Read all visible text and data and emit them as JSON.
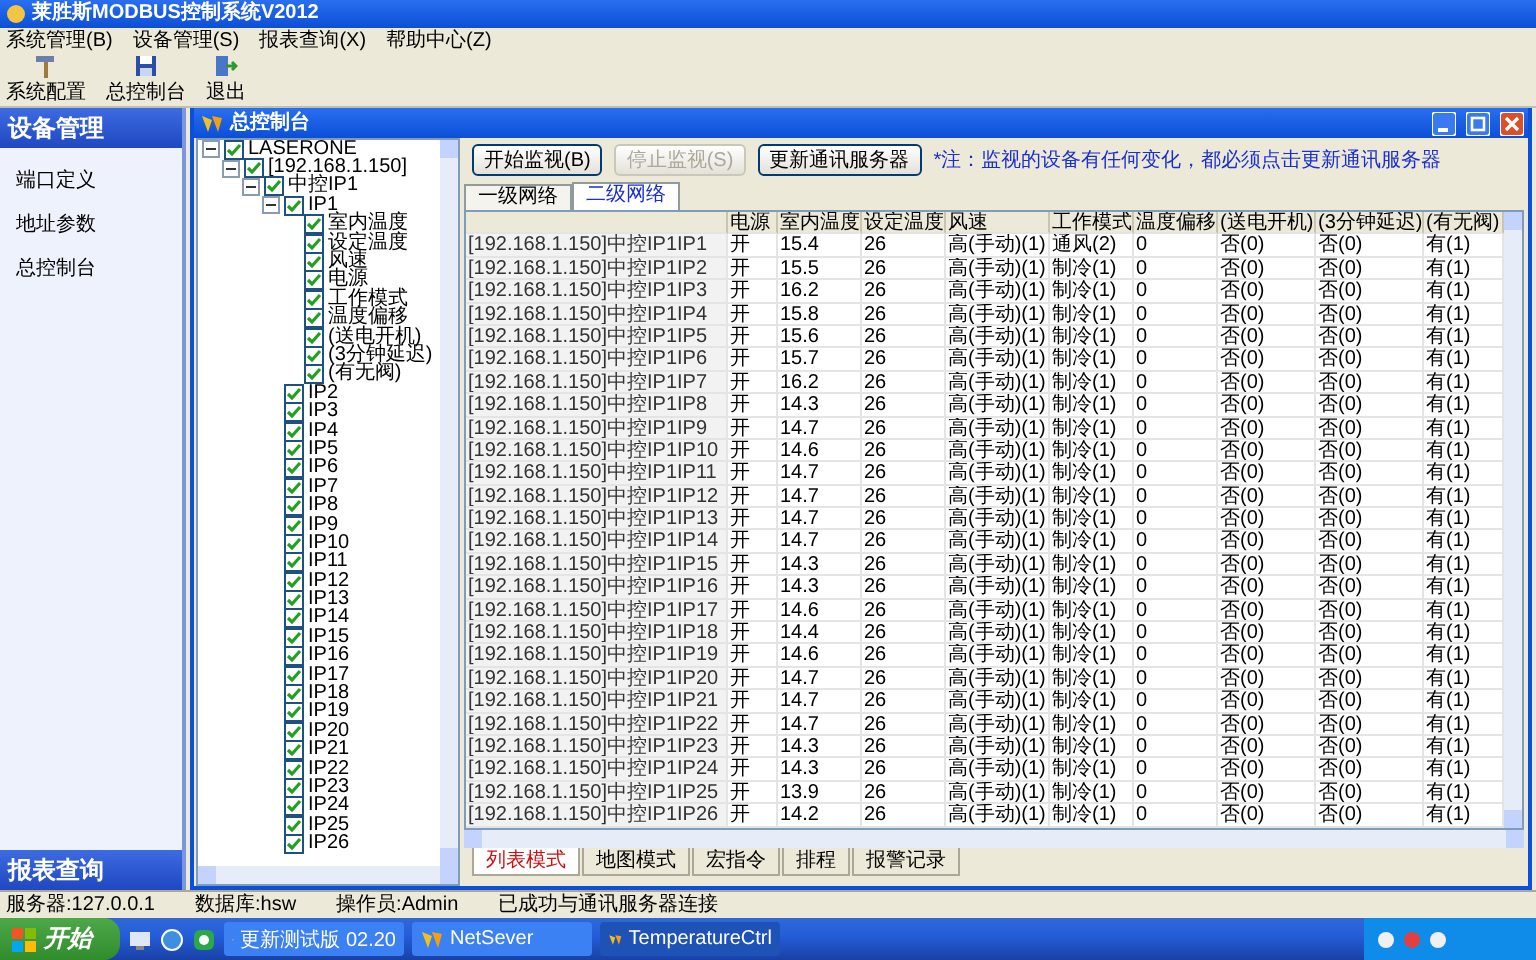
{
  "window": {
    "title": "莱胜斯MODBUS控制系统V2012"
  },
  "menu": [
    "系统管理(B)",
    "设备管理(S)",
    "报表查询(X)",
    "帮助中心(Z)"
  ],
  "toolbar": [
    {
      "label": "系统配置",
      "kind": "config"
    },
    {
      "label": "总控制台",
      "kind": "console"
    },
    {
      "label": "退出",
      "kind": "exit"
    }
  ],
  "sidebar": {
    "title": "设备管理",
    "items": [
      "端口定义",
      "地址参数",
      "总控制台"
    ],
    "footer": "报表查询"
  },
  "child_window": {
    "title": "总控制台"
  },
  "tree": [
    {
      "label": "LASERONE",
      "checked": true,
      "expanded": true,
      "children": [
        {
          "label": "[192.168.1.150]",
          "checked": true,
          "expanded": true,
          "children": [
            {
              "label": "中控IP1",
              "checked": true,
              "expanded": true,
              "children": [
                {
                  "label": "IP1",
                  "checked": true,
                  "expanded": true,
                  "children": [
                    {
                      "label": "室内温度",
                      "checked": true
                    },
                    {
                      "label": "设定温度",
                      "checked": true
                    },
                    {
                      "label": "风速",
                      "checked": true
                    },
                    {
                      "label": "电源",
                      "checked": true
                    },
                    {
                      "label": "工作模式",
                      "checked": true
                    },
                    {
                      "label": "温度偏移",
                      "checked": true
                    },
                    {
                      "label": "(送电开机)",
                      "checked": true
                    },
                    {
                      "label": "(3分钟延迟)",
                      "checked": true
                    },
                    {
                      "label": "(有无阀)",
                      "checked": true
                    }
                  ]
                },
                {
                  "label": "IP2",
                  "checked": true
                },
                {
                  "label": "IP3",
                  "checked": true
                },
                {
                  "label": "IP4",
                  "checked": true
                },
                {
                  "label": "IP5",
                  "checked": true
                },
                {
                  "label": "IP6",
                  "checked": true
                },
                {
                  "label": "IP7",
                  "checked": true
                },
                {
                  "label": "IP8",
                  "checked": true
                },
                {
                  "label": "IP9",
                  "checked": true
                },
                {
                  "label": "IP10",
                  "checked": true
                },
                {
                  "label": "IP11",
                  "checked": true
                },
                {
                  "label": "IP12",
                  "checked": true
                },
                {
                  "label": "IP13",
                  "checked": true
                },
                {
                  "label": "IP14",
                  "checked": true
                },
                {
                  "label": "IP15",
                  "checked": true
                },
                {
                  "label": "IP16",
                  "checked": true
                },
                {
                  "label": "IP17",
                  "checked": true
                },
                {
                  "label": "IP18",
                  "checked": true
                },
                {
                  "label": "IP19",
                  "checked": true
                },
                {
                  "label": "IP20",
                  "checked": true
                },
                {
                  "label": "IP21",
                  "checked": true
                },
                {
                  "label": "IP22",
                  "checked": true
                },
                {
                  "label": "IP23",
                  "checked": true
                },
                {
                  "label": "IP24",
                  "checked": true
                },
                {
                  "label": "IP25",
                  "checked": true
                },
                {
                  "label": "IP26",
                  "checked": true
                }
              ]
            }
          ]
        }
      ]
    }
  ],
  "buttons": [
    {
      "label": "开始监视(B)",
      "disabled": false
    },
    {
      "label": "停止监视(S)",
      "disabled": true
    },
    {
      "label": "更新通讯服务器",
      "disabled": false
    }
  ],
  "note": "*注：监视的设备有任何变化，都必须点击更新通讯服务器",
  "tabs": [
    {
      "label": "一级网络",
      "selected": false
    },
    {
      "label": "二级网络",
      "selected": true
    }
  ],
  "table": {
    "columns": [
      "",
      "电源",
      "室内温度",
      "设定温度",
      "风速",
      "工作模式",
      "温度偏移",
      "(送电开机)",
      "(3分钟延迟)",
      "(有无阀)"
    ],
    "rows": [
      [
        "[192.168.1.150]中控IP1IP1",
        "开",
        "15.4",
        "26",
        "高(手动)(1)",
        "通风(2)",
        "0",
        "否(0)",
        "否(0)",
        "有(1)"
      ],
      [
        "[192.168.1.150]中控IP1IP2",
        "开",
        "15.5",
        "26",
        "高(手动)(1)",
        "制冷(1)",
        "0",
        "否(0)",
        "否(0)",
        "有(1)"
      ],
      [
        "[192.168.1.150]中控IP1IP3",
        "开",
        "16.2",
        "26",
        "高(手动)(1)",
        "制冷(1)",
        "0",
        "否(0)",
        "否(0)",
        "有(1)"
      ],
      [
        "[192.168.1.150]中控IP1IP4",
        "开",
        "15.8",
        "26",
        "高(手动)(1)",
        "制冷(1)",
        "0",
        "否(0)",
        "否(0)",
        "有(1)"
      ],
      [
        "[192.168.1.150]中控IP1IP5",
        "开",
        "15.6",
        "26",
        "高(手动)(1)",
        "制冷(1)",
        "0",
        "否(0)",
        "否(0)",
        "有(1)"
      ],
      [
        "[192.168.1.150]中控IP1IP6",
        "开",
        "15.7",
        "26",
        "高(手动)(1)",
        "制冷(1)",
        "0",
        "否(0)",
        "否(0)",
        "有(1)"
      ],
      [
        "[192.168.1.150]中控IP1IP7",
        "开",
        "16.2",
        "26",
        "高(手动)(1)",
        "制冷(1)",
        "0",
        "否(0)",
        "否(0)",
        "有(1)"
      ],
      [
        "[192.168.1.150]中控IP1IP8",
        "开",
        "14.3",
        "26",
        "高(手动)(1)",
        "制冷(1)",
        "0",
        "否(0)",
        "否(0)",
        "有(1)"
      ],
      [
        "[192.168.1.150]中控IP1IP9",
        "开",
        "14.7",
        "26",
        "高(手动)(1)",
        "制冷(1)",
        "0",
        "否(0)",
        "否(0)",
        "有(1)"
      ],
      [
        "[192.168.1.150]中控IP1IP10",
        "开",
        "14.6",
        "26",
        "高(手动)(1)",
        "制冷(1)",
        "0",
        "否(0)",
        "否(0)",
        "有(1)"
      ],
      [
        "[192.168.1.150]中控IP1IP11",
        "开",
        "14.7",
        "26",
        "高(手动)(1)",
        "制冷(1)",
        "0",
        "否(0)",
        "否(0)",
        "有(1)"
      ],
      [
        "[192.168.1.150]中控IP1IP12",
        "开",
        "14.7",
        "26",
        "高(手动)(1)",
        "制冷(1)",
        "0",
        "否(0)",
        "否(0)",
        "有(1)"
      ],
      [
        "[192.168.1.150]中控IP1IP13",
        "开",
        "14.7",
        "26",
        "高(手动)(1)",
        "制冷(1)",
        "0",
        "否(0)",
        "否(0)",
        "有(1)"
      ],
      [
        "[192.168.1.150]中控IP1IP14",
        "开",
        "14.7",
        "26",
        "高(手动)(1)",
        "制冷(1)",
        "0",
        "否(0)",
        "否(0)",
        "有(1)"
      ],
      [
        "[192.168.1.150]中控IP1IP15",
        "开",
        "14.3",
        "26",
        "高(手动)(1)",
        "制冷(1)",
        "0",
        "否(0)",
        "否(0)",
        "有(1)"
      ],
      [
        "[192.168.1.150]中控IP1IP16",
        "开",
        "14.3",
        "26",
        "高(手动)(1)",
        "制冷(1)",
        "0",
        "否(0)",
        "否(0)",
        "有(1)"
      ],
      [
        "[192.168.1.150]中控IP1IP17",
        "开",
        "14.6",
        "26",
        "高(手动)(1)",
        "制冷(1)",
        "0",
        "否(0)",
        "否(0)",
        "有(1)"
      ],
      [
        "[192.168.1.150]中控IP1IP18",
        "开",
        "14.4",
        "26",
        "高(手动)(1)",
        "制冷(1)",
        "0",
        "否(0)",
        "否(0)",
        "有(1)"
      ],
      [
        "[192.168.1.150]中控IP1IP19",
        "开",
        "14.6",
        "26",
        "高(手动)(1)",
        "制冷(1)",
        "0",
        "否(0)",
        "否(0)",
        "有(1)"
      ],
      [
        "[192.168.1.150]中控IP1IP20",
        "开",
        "14.7",
        "26",
        "高(手动)(1)",
        "制冷(1)",
        "0",
        "否(0)",
        "否(0)",
        "有(1)"
      ],
      [
        "[192.168.1.150]中控IP1IP21",
        "开",
        "14.7",
        "26",
        "高(手动)(1)",
        "制冷(1)",
        "0",
        "否(0)",
        "否(0)",
        "有(1)"
      ],
      [
        "[192.168.1.150]中控IP1IP22",
        "开",
        "14.7",
        "26",
        "高(手动)(1)",
        "制冷(1)",
        "0",
        "否(0)",
        "否(0)",
        "有(1)"
      ],
      [
        "[192.168.1.150]中控IP1IP23",
        "开",
        "14.3",
        "26",
        "高(手动)(1)",
        "制冷(1)",
        "0",
        "否(0)",
        "否(0)",
        "有(1)"
      ],
      [
        "[192.168.1.150]中控IP1IP24",
        "开",
        "14.3",
        "26",
        "高(手动)(1)",
        "制冷(1)",
        "0",
        "否(0)",
        "否(0)",
        "有(1)"
      ],
      [
        "[192.168.1.150]中控IP1IP25",
        "开",
        "13.9",
        "26",
        "高(手动)(1)",
        "制冷(1)",
        "0",
        "否(0)",
        "否(0)",
        "有(1)"
      ],
      [
        "[192.168.1.150]中控IP1IP26",
        "开",
        "14.2",
        "26",
        "高(手动)(1)",
        "制冷(1)",
        "0",
        "否(0)",
        "否(0)",
        "有(1)"
      ]
    ]
  },
  "view_tabs": [
    {
      "label": "列表模式",
      "selected": true
    },
    {
      "label": "地图模式",
      "selected": false
    },
    {
      "label": "宏指令",
      "selected": false
    },
    {
      "label": "排程",
      "selected": false
    },
    {
      "label": "报警记录",
      "selected": false
    }
  ],
  "status_bar": [
    "服务器:127.0.0.1",
    "数据库:hsw",
    "操作员:Admin",
    "已成功与通讯服务器连接"
  ],
  "taskbar": {
    "start": "开始",
    "tasks": [
      {
        "label": "更新测试版 02.20",
        "selected": false
      },
      {
        "label": "NetSever",
        "selected": false
      },
      {
        "label": "TemperatureCtrl",
        "selected": true
      }
    ]
  }
}
